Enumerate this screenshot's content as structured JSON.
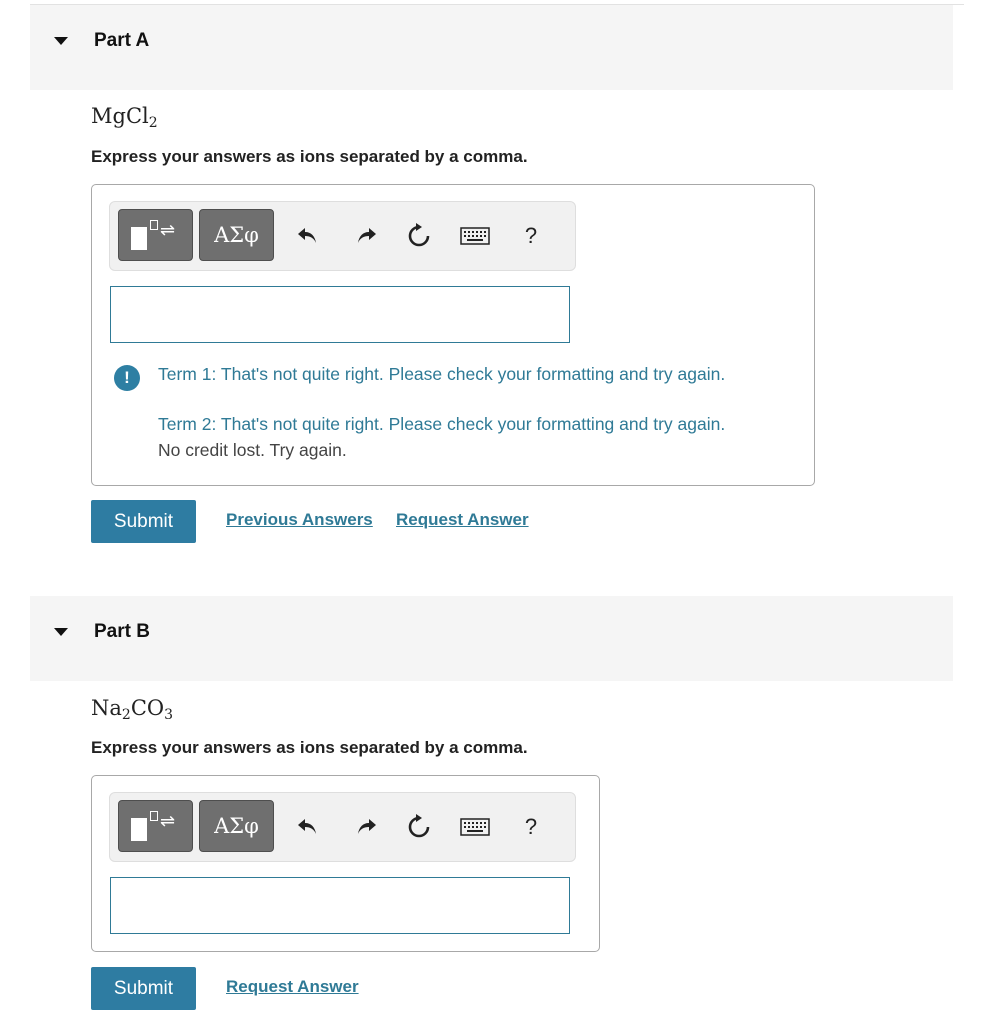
{
  "part_a": {
    "title": "Part A",
    "formula": {
      "base1": "MgCl",
      "sub1": "2"
    },
    "instruction": "Express your answers as ions separated by a comma.",
    "toolbar": {
      "greek_label": "ΑΣφ",
      "help_label": "?"
    },
    "feedback": {
      "icon": "!",
      "term1": "Term 1: That's not quite right. Please check your formatting and try again.",
      "term2": "Term 2: That's not quite right. Please check your formatting and try again.",
      "no_credit": "No credit lost. Try again."
    },
    "submit_label": "Submit",
    "previous_answers_label": "Previous Answers",
    "request_answer_label": "Request Answer"
  },
  "part_b": {
    "title": "Part B",
    "formula": {
      "base1": "Na",
      "sub1": "2",
      "base2": "CO",
      "sub2": "3"
    },
    "instruction": "Express your answers as ions separated by a comma.",
    "toolbar": {
      "greek_label": "ΑΣφ",
      "help_label": "?"
    },
    "submit_label": "Submit",
    "request_answer_label": "Request Answer"
  },
  "icons": [
    "caret-down-icon",
    "template-icon",
    "undo-icon",
    "redo-icon",
    "reset-icon",
    "keyboard-icon",
    "help-icon",
    "alert-icon"
  ],
  "colors": {
    "accent": "#2e7ca2",
    "link": "#2f7a96",
    "toolbar_button": "#6f6f6f",
    "header_bg": "#f5f5f5"
  }
}
